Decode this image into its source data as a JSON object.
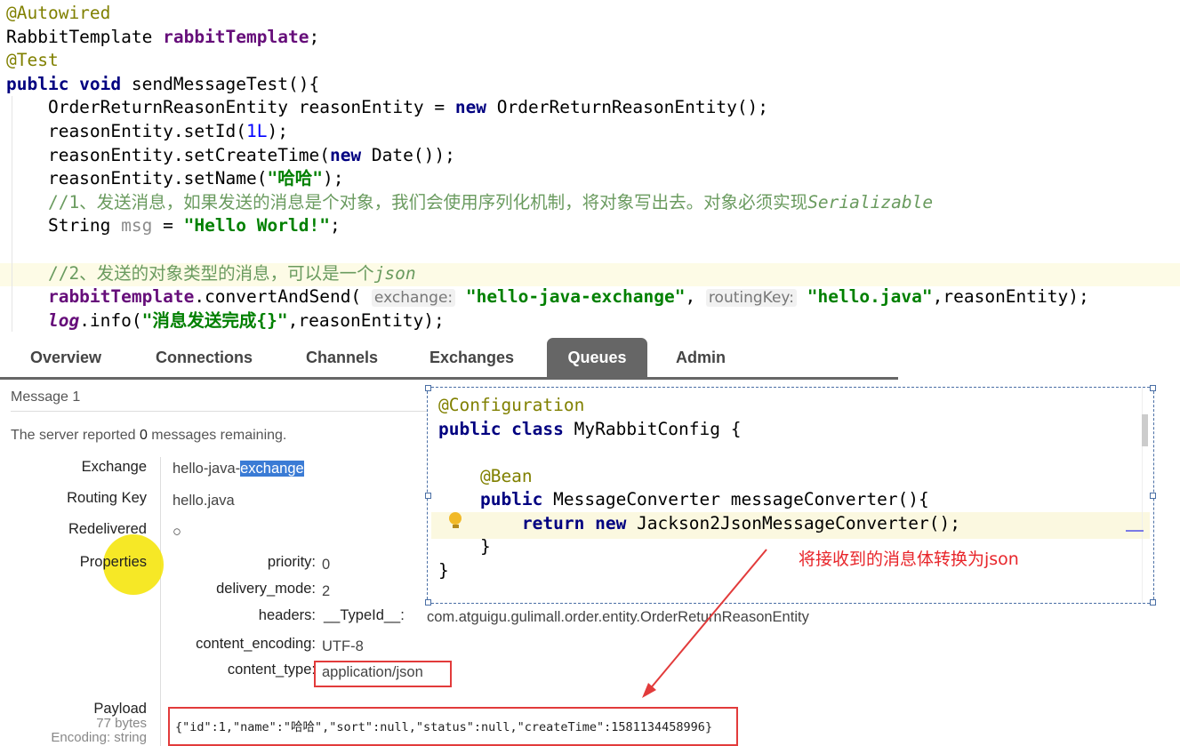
{
  "editor": {
    "lines": [
      {
        "id": "l1",
        "parts": [
          {
            "c": "ann",
            "t": "@Autowired"
          }
        ]
      },
      {
        "id": "l2",
        "parts": [
          {
            "c": "",
            "t": "RabbitTemplate "
          },
          {
            "c": "fld",
            "t": "rabbitTemplate"
          },
          {
            "c": "",
            "t": ";"
          }
        ]
      },
      {
        "id": "l3",
        "parts": [
          {
            "c": "ann",
            "t": "@Test"
          }
        ]
      },
      {
        "id": "l4",
        "parts": [
          {
            "c": "kw",
            "t": "public void "
          },
          {
            "c": "",
            "t": "sendMessageTest(){"
          }
        ]
      },
      {
        "id": "l5",
        "parts": [
          {
            "c": "",
            "t": "    OrderReturnReasonEntity reasonEntity = "
          },
          {
            "c": "kw",
            "t": "new "
          },
          {
            "c": "",
            "t": "OrderReturnReasonEntity();"
          }
        ]
      },
      {
        "id": "l6",
        "parts": [
          {
            "c": "",
            "t": "    reasonEntity.setId("
          },
          {
            "c": "num",
            "t": "1L"
          },
          {
            "c": "",
            "t": ");"
          }
        ]
      },
      {
        "id": "l7",
        "parts": [
          {
            "c": "",
            "t": "    reasonEntity.setCreateTime("
          },
          {
            "c": "kw",
            "t": "new "
          },
          {
            "c": "",
            "t": "Date());"
          }
        ]
      },
      {
        "id": "l8",
        "parts": [
          {
            "c": "",
            "t": "    reasonEntity.setName("
          },
          {
            "c": "str",
            "t": "\"哈哈\""
          },
          {
            "c": "",
            "t": ");"
          }
        ]
      },
      {
        "id": "l9",
        "parts": [
          {
            "c": "cmt",
            "t": "    //1、发送消息，如果发送的消息是个对象，我们会使用序列化机制，将对象写出去。对象必须实现"
          },
          {
            "c": "cmt-i",
            "t": "Serializable"
          }
        ]
      },
      {
        "id": "l10",
        "parts": [
          {
            "c": "",
            "t": "    String "
          },
          {
            "c": "grey",
            "t": "msg"
          },
          {
            "c": "",
            "t": " = "
          },
          {
            "c": "str",
            "t": "\"Hello World!\""
          },
          {
            "c": "",
            "t": ";"
          }
        ]
      },
      {
        "id": "l11",
        "parts": [
          {
            "c": "",
            "t": ""
          }
        ]
      },
      {
        "id": "l12",
        "parts": [
          {
            "c": "cmt",
            "t": "    //2、发送的对象类型的消息，可以是一个"
          },
          {
            "c": "cmt-i",
            "t": "json"
          }
        ]
      },
      {
        "id": "l13",
        "parts": [
          {
            "c": "fld",
            "t": "    rabbitTemplate"
          },
          {
            "c": "",
            "t": ".convertAndSend( "
          },
          {
            "c": "hint",
            "t": "exchange:"
          },
          {
            "c": "",
            "t": " "
          },
          {
            "c": "str",
            "t": "\"hello-java-exchange\""
          },
          {
            "c": "",
            "t": ", "
          },
          {
            "c": "hint",
            "t": "routingKey:"
          },
          {
            "c": "",
            "t": " "
          },
          {
            "c": "str",
            "t": "\"hello.java\""
          },
          {
            "c": "",
            "t": ",reasonEntity);"
          }
        ]
      },
      {
        "id": "l14",
        "parts": [
          {
            "c": "static",
            "t": "    log"
          },
          {
            "c": "",
            "t": ".info("
          },
          {
            "c": "str",
            "t": "\"消息发送完成{}\""
          },
          {
            "c": "",
            "t": ",reasonEntity);"
          }
        ]
      }
    ]
  },
  "tabs": [
    "Overview",
    "Connections",
    "Channels",
    "Exchanges",
    "Queues",
    "Admin"
  ],
  "active_tab": "Queues",
  "message": {
    "title": "Message 1",
    "remaining_prefix": "The server reported ",
    "remaining_count": "0",
    "remaining_suffix": " messages remaining.",
    "exchange_label": "Exchange",
    "exchange_value_prefix": "hello-java-",
    "exchange_value_selected": "exchange",
    "routing_key_label": "Routing Key",
    "routing_key_value": "hello.java",
    "redelivered_label": "Redelivered",
    "redelivered_value": "○",
    "properties_label": "Properties",
    "priority_label": "priority:",
    "priority_value": "0",
    "delivery_mode_label": "delivery_mode:",
    "delivery_mode_value": "2",
    "headers_label": "headers:",
    "headers_key": "__TypeId__:",
    "headers_value": "com.atguigu.gulimall.order.entity.OrderReturnReasonEntity",
    "content_encoding_label": "content_encoding:",
    "content_encoding_value": "UTF-8",
    "content_type_label": "content_type:",
    "content_type_value": "application/json",
    "payload_label": "Payload",
    "payload_size": "77 bytes",
    "payload_encoding": "Encoding: string",
    "payload_value": "{\"id\":1,\"name\":\"哈哈\",\"sort\":null,\"status\":null,\"createTime\":1581134458996}"
  },
  "config": {
    "lines": [
      {
        "id": "c1",
        "parts": [
          {
            "c": "ann",
            "t": "@Configuration"
          }
        ]
      },
      {
        "id": "c2",
        "parts": [
          {
            "c": "kw",
            "t": "public class "
          },
          {
            "c": "",
            "t": "MyRabbitConfig {"
          }
        ]
      },
      {
        "id": "c3",
        "parts": [
          {
            "c": "",
            "t": ""
          }
        ]
      },
      {
        "id": "c4",
        "parts": [
          {
            "c": "ann",
            "t": "    @Bean"
          }
        ]
      },
      {
        "id": "c5",
        "parts": [
          {
            "c": "kw",
            "t": "    public "
          },
          {
            "c": "",
            "t": "MessageConverter messageConverter(){"
          }
        ]
      },
      {
        "id": "c6",
        "parts": [
          {
            "c": "kw",
            "t": "        return new "
          },
          {
            "c": "",
            "t": "Jackson2JsonMessageConverter();"
          }
        ]
      },
      {
        "id": "c7",
        "parts": [
          {
            "c": "",
            "t": "    }"
          }
        ]
      },
      {
        "id": "c8",
        "parts": [
          {
            "c": "",
            "t": "}"
          }
        ]
      }
    ],
    "annotation": "将接收到的消息体转换为json"
  },
  "colors": {
    "accent_red": "#e23b3b",
    "tab_active": "#666666",
    "selection": "#3a7bd5"
  }
}
